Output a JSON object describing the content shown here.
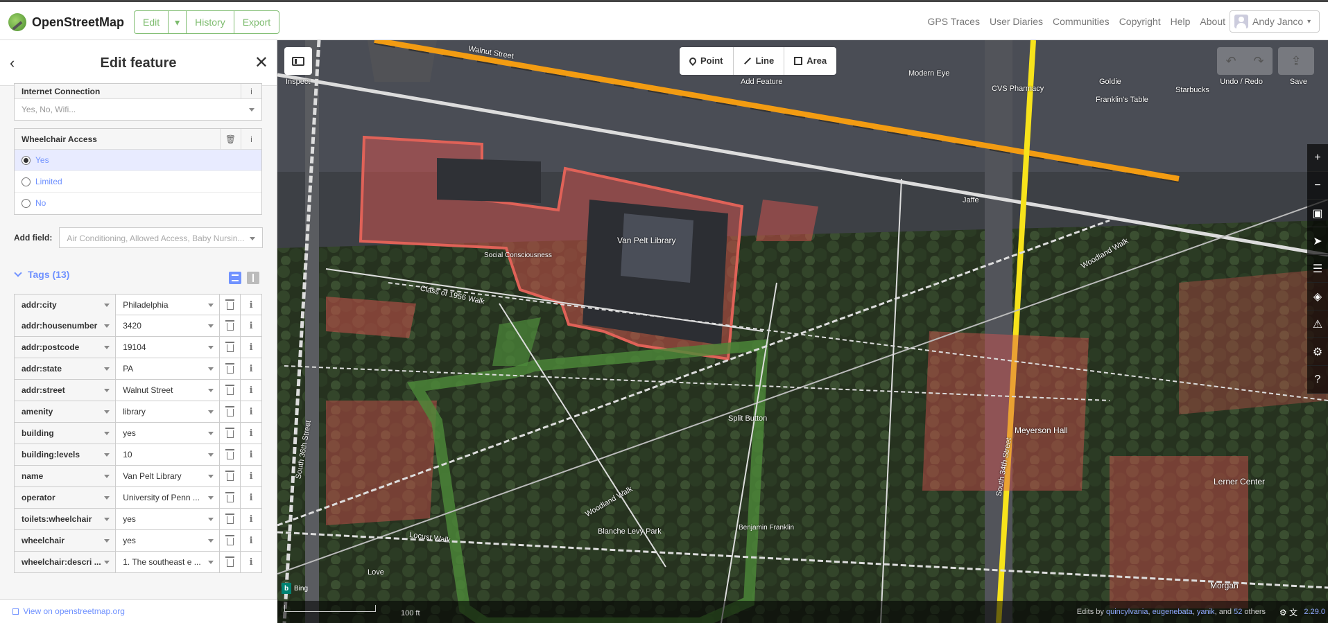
{
  "topbar": {
    "logo_text": "OpenStreetMap",
    "edit_label": "Edit",
    "history_label": "History",
    "export_label": "Export",
    "links": [
      "GPS Traces",
      "User Diaries",
      "Communities",
      "Copyright",
      "Help",
      "About"
    ],
    "user_name": "Andy Janco"
  },
  "sidebar": {
    "title": "Edit feature",
    "internet": {
      "label": "Internet Connection",
      "placeholder": "Yes, No, Wifi..."
    },
    "wheelchair": {
      "label": "Wheelchair Access",
      "options": [
        "Yes",
        "Limited",
        "No"
      ],
      "selected": "Yes"
    },
    "add_field": {
      "label": "Add field:",
      "placeholder": "Air Conditioning, Allowed Access, Baby Nursin..."
    },
    "tags_title": "Tags (13)",
    "tags": [
      {
        "key": "addr:city",
        "value": "Philadelphia"
      },
      {
        "key": "addr:housenumber",
        "value": "3420"
      },
      {
        "key": "addr:postcode",
        "value": "19104"
      },
      {
        "key": "addr:state",
        "value": "PA"
      },
      {
        "key": "addr:street",
        "value": "Walnut Street"
      },
      {
        "key": "amenity",
        "value": "library"
      },
      {
        "key": "building",
        "value": "yes"
      },
      {
        "key": "building:levels",
        "value": "10"
      },
      {
        "key": "name",
        "value": "Van Pelt Library"
      },
      {
        "key": "operator",
        "value": "University of Penn ..."
      },
      {
        "key": "toilets:wheelchair",
        "value": "yes"
      },
      {
        "key": "wheelchair",
        "value": "yes"
      },
      {
        "key": "wheelchair:descri ...",
        "value": "1. The southeast e ..."
      }
    ],
    "add_tag_label": "+",
    "view_on_osm": "View on openstreetmap.org"
  },
  "map": {
    "modes": {
      "point": "Point",
      "line": "Line",
      "area": "Area"
    },
    "add_feature_label": "Add Feature",
    "inspect_label": "Inspect",
    "undo_redo_label": "Undo / Redo",
    "save_label": "Save",
    "labels": {
      "walnut": "Walnut Street",
      "modern_eye": "Modern Eye",
      "cvs": "CVS Pharmacy",
      "goldie": "Goldie",
      "starbucks": "Starbucks",
      "franklins": "Franklin's Table",
      "jaffe": "Jaffe",
      "van_pelt": "Van Pelt Library",
      "social": "Social Consciousness",
      "class1956": "Class of 1956 Walk",
      "woodland1": "Woodland Walk",
      "woodland2": "Woodland Walk",
      "split_button": "Split Button",
      "meyerson": "Meyerson Hall",
      "south36": "South 36th Street",
      "south34": "South 34th Street",
      "lerner": "Lerner Center",
      "blanche": "Blanche Levy Park",
      "ben": "Benjamin Franklin",
      "locust": "Locust Walk",
      "love": "Love",
      "morgan": "Morgan",
      "bing": "Bing"
    },
    "footer": {
      "scale": "100 ft",
      "edits_prefix": "Edits by",
      "editors": [
        "quincylvania",
        "eugenebata",
        "yanik"
      ],
      "and_text": "and",
      "others_count": "52",
      "others_text": "others",
      "version": "2.29.0"
    },
    "colors": {
      "building": "#d9534f",
      "park": "#4d8a3a",
      "primary_road": "#f39c12",
      "secondary_road": "#f7e31b"
    }
  }
}
